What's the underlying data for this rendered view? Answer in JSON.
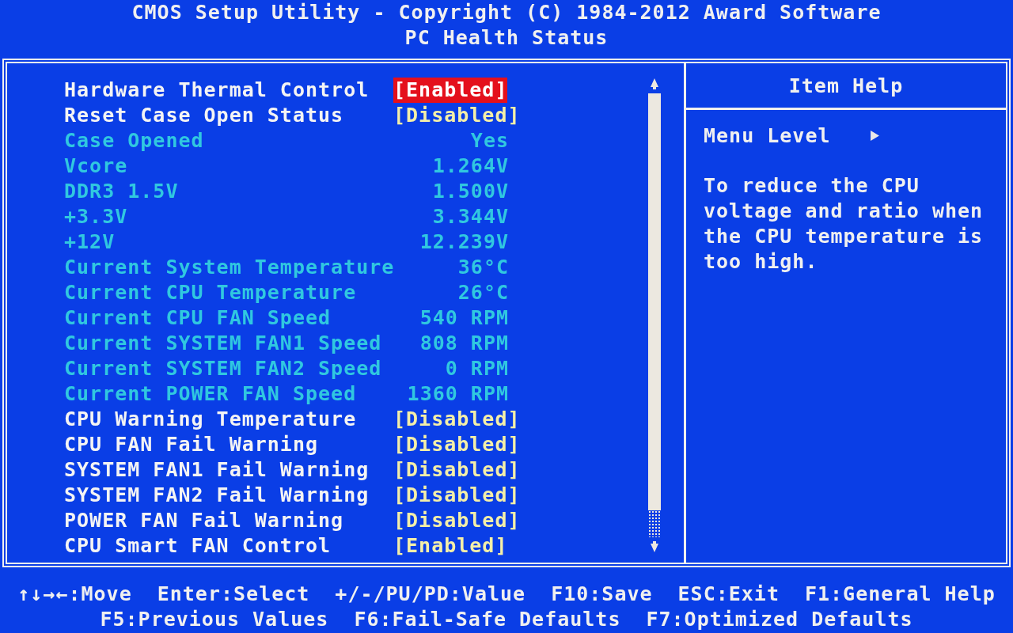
{
  "header": {
    "title": "CMOS Setup Utility - Copyright (C) 1984-2012 Award Software",
    "subtitle": "PC Health Status"
  },
  "items": [
    {
      "kind": "setting",
      "label": "Hardware Thermal Control",
      "value": "[Enabled]",
      "selected": true
    },
    {
      "kind": "setting",
      "label": "Reset Case Open Status",
      "value": "[Disabled]",
      "selected": false
    },
    {
      "kind": "reading",
      "label": "Case Opened",
      "value": "Yes",
      "selected": false
    },
    {
      "kind": "reading",
      "label": "Vcore",
      "value": "1.264V",
      "selected": false
    },
    {
      "kind": "reading",
      "label": "DDR3 1.5V",
      "value": "1.500V",
      "selected": false
    },
    {
      "kind": "reading",
      "label": "+3.3V",
      "value": "3.344V",
      "selected": false
    },
    {
      "kind": "reading",
      "label": "+12V",
      "value": "12.239V",
      "selected": false
    },
    {
      "kind": "reading",
      "label": "Current System Temperature",
      "value": "36°C",
      "selected": false
    },
    {
      "kind": "reading",
      "label": "Current CPU Temperature",
      "value": "26°C",
      "selected": false
    },
    {
      "kind": "reading",
      "label": "Current CPU FAN Speed",
      "value": "540 RPM",
      "selected": false
    },
    {
      "kind": "reading",
      "label": "Current SYSTEM FAN1 Speed",
      "value": "808 RPM",
      "selected": false
    },
    {
      "kind": "reading",
      "label": "Current SYSTEM FAN2 Speed",
      "value": "0 RPM",
      "selected": false
    },
    {
      "kind": "reading",
      "label": "Current POWER FAN Speed",
      "value": "1360 RPM",
      "selected": false
    },
    {
      "kind": "setting",
      "label": "CPU Warning Temperature",
      "value": "[Disabled]",
      "selected": false
    },
    {
      "kind": "setting",
      "label": "CPU FAN Fail Warning",
      "value": "[Disabled]",
      "selected": false
    },
    {
      "kind": "setting",
      "label": "SYSTEM FAN1 Fail Warning",
      "value": "[Disabled]",
      "selected": false
    },
    {
      "kind": "setting",
      "label": "SYSTEM FAN2 Fail Warning",
      "value": "[Disabled]",
      "selected": false
    },
    {
      "kind": "setting",
      "label": "POWER FAN Fail Warning",
      "value": "[Disabled]",
      "selected": false
    },
    {
      "kind": "setting",
      "label": "CPU Smart FAN Control",
      "value": "[Enabled]",
      "selected": false
    }
  ],
  "help": {
    "title": "Item Help",
    "menu_level": "Menu Level",
    "text": "To reduce the CPU voltage and ratio when the CPU temperature is too high."
  },
  "footer": [
    [
      "↑↓→←:Move",
      "Enter:Select",
      "+/-/PU/PD:Value",
      "F10:Save",
      "ESC:Exit",
      "F1:General Help"
    ],
    [
      "F5:Previous Values",
      "F6:Fail-Safe Defaults",
      "F7:Optimized Defaults"
    ]
  ]
}
